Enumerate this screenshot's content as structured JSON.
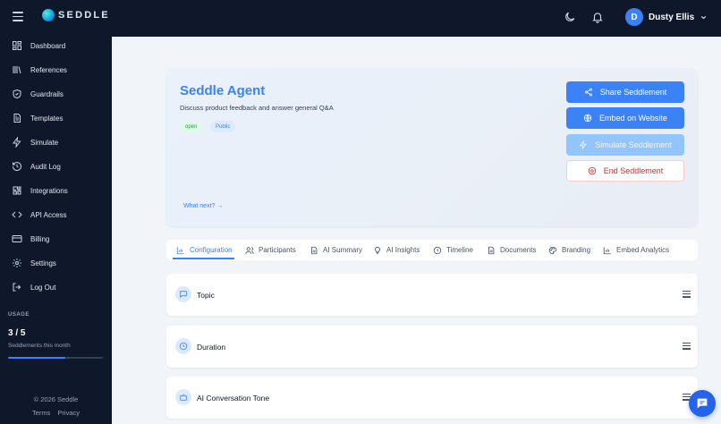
{
  "app": {
    "logo_text": "SEDDLE"
  },
  "header": {
    "user": {
      "initial": "D",
      "name": "Dusty Ellis"
    }
  },
  "sidebar": {
    "items": [
      {
        "label": "Dashboard",
        "icon": "grid-icon"
      },
      {
        "label": "References",
        "icon": "books-icon"
      },
      {
        "label": "Guardrails",
        "icon": "shield-icon"
      },
      {
        "label": "Templates",
        "icon": "document-icon"
      },
      {
        "label": "Simulate",
        "icon": "zap-icon"
      },
      {
        "label": "Audit Log",
        "icon": "history-icon"
      },
      {
        "label": "Integrations",
        "icon": "puzzle-icon"
      },
      {
        "label": "API Access",
        "icon": "code-icon"
      },
      {
        "label": "Billing",
        "icon": "credit-card-icon"
      },
      {
        "label": "Settings",
        "icon": "gear-icon"
      },
      {
        "label": "Log Out",
        "icon": "logout-icon"
      }
    ],
    "usage": {
      "title": "USAGE",
      "count": "3 / 5",
      "description": "Seddlements this month",
      "used": 3,
      "limit": 5
    },
    "footer": {
      "copyright": "© 2026 Seddle",
      "terms": "Terms",
      "privacy": "Privacy"
    }
  },
  "agent": {
    "title": "Seddle Agent",
    "description": "Discuss product feedback and answer general Q&A",
    "badges": {
      "status": "open",
      "visibility": "Public"
    },
    "what_next": "What next? →",
    "actions": {
      "share": "Share Seddlement",
      "embed": "Embed on Website",
      "simulate": "Simulate Seddlement",
      "end": "End Seddlement"
    }
  },
  "tabs": [
    {
      "label": "Configuration",
      "active": true
    },
    {
      "label": "Participants"
    },
    {
      "label": "AI Summary"
    },
    {
      "label": "AI Insights"
    },
    {
      "label": "Timeline"
    },
    {
      "label": "Documents"
    },
    {
      "label": "Branding"
    },
    {
      "label": "Embed Analytics"
    }
  ],
  "sections": [
    {
      "title": "Topic",
      "icon": "message-icon"
    },
    {
      "title": "Duration",
      "icon": "clock-icon"
    },
    {
      "title": "AI Conversation Tone",
      "icon": "robot-icon"
    }
  ],
  "colors": {
    "accent": "#3b82f6",
    "sidebar": "#0f172a",
    "danger": "#dc2626",
    "success": "#16a34a"
  }
}
